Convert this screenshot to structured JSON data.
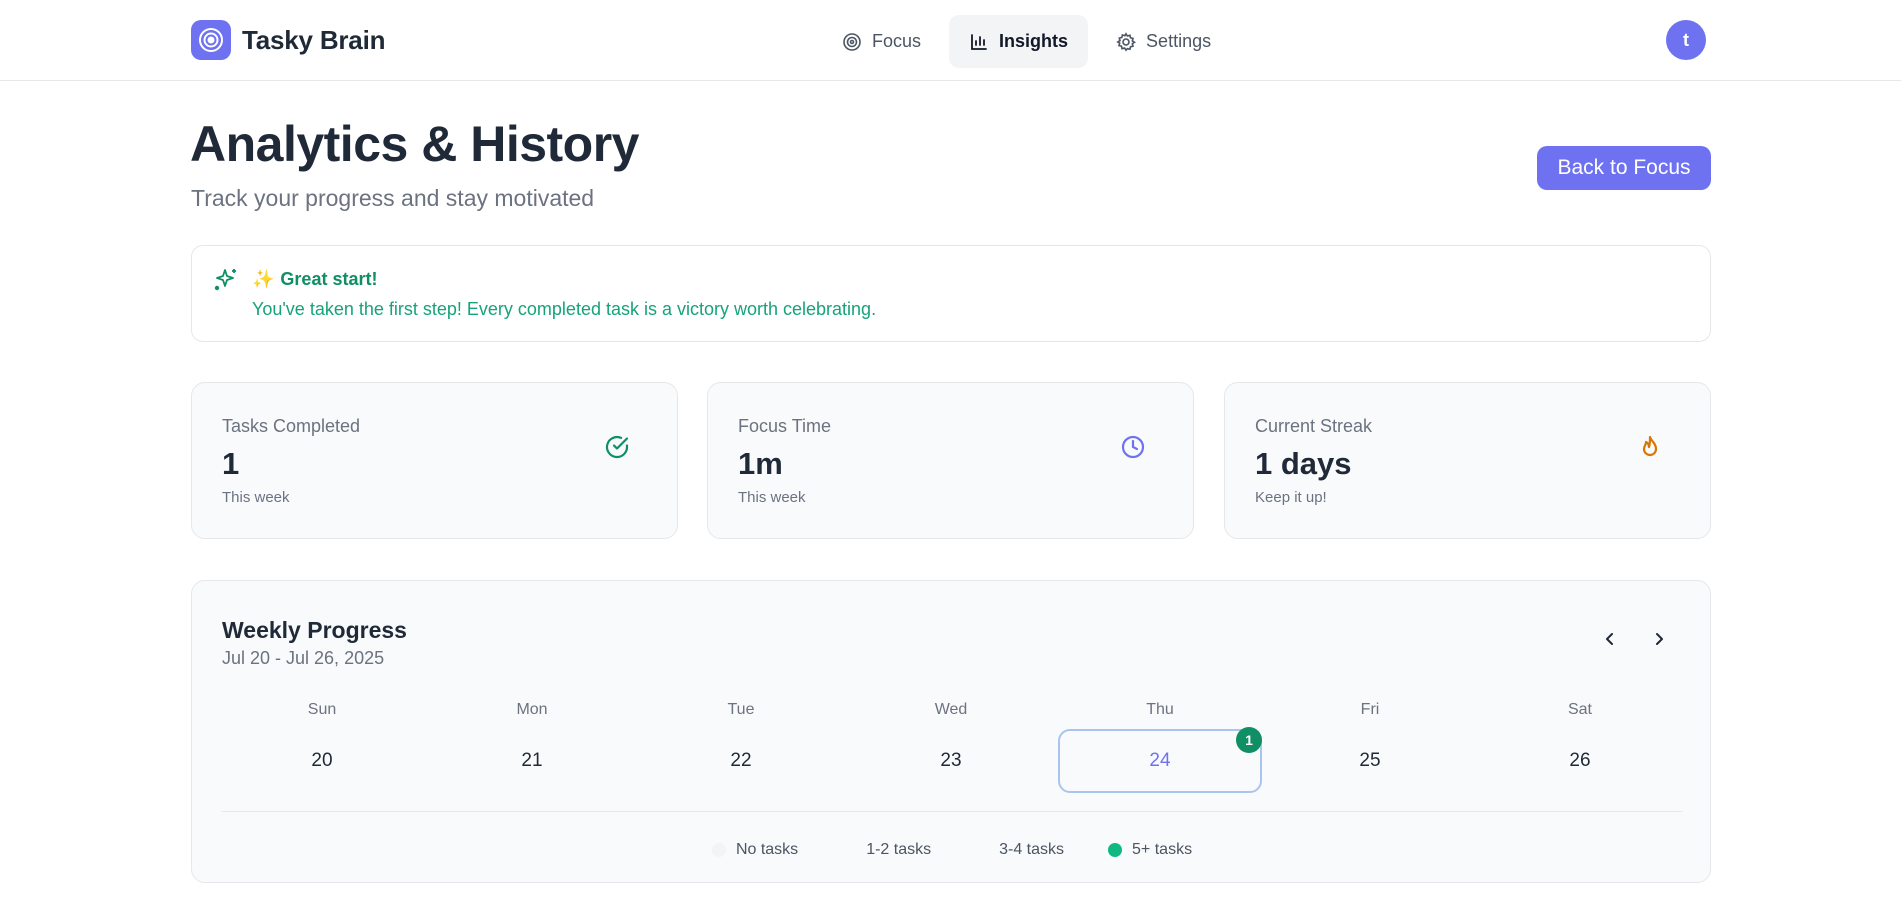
{
  "app": {
    "name": "Tasky Brain",
    "avatar_initial": "t",
    "accent_color": "#6e72f0"
  },
  "nav": {
    "items": [
      {
        "label": "Focus",
        "icon": "target-icon",
        "active": false
      },
      {
        "label": "Insights",
        "icon": "bar-chart-icon",
        "active": true
      },
      {
        "label": "Settings",
        "icon": "gear-icon",
        "active": false
      }
    ]
  },
  "page": {
    "title": "Analytics & History",
    "subtitle": "Track your progress and stay motivated",
    "back_button_label": "Back to Focus"
  },
  "banner": {
    "emoji": "✨",
    "title": "Great start!",
    "message": "You've taken the first step! Every completed task is a victory worth celebrating.",
    "icon": "sparkles-icon",
    "color": "#0f8f63"
  },
  "stats": [
    {
      "label": "Tasks Completed",
      "value": "1",
      "note": "This week",
      "icon": "check-circle-icon",
      "color": "#0f8f63"
    },
    {
      "label": "Focus Time",
      "value": "1m",
      "note": "This week",
      "icon": "clock-icon",
      "color": "#6e72f0"
    },
    {
      "label": "Current Streak",
      "value": "1 days",
      "note": "Keep it up!",
      "icon": "flame-icon",
      "color": "#d97706"
    }
  ],
  "weekly": {
    "title": "Weekly Progress",
    "range": "Jul 20 - Jul 26, 2025",
    "days": [
      {
        "name": "Sun",
        "date": "20",
        "count": 0,
        "today": false
      },
      {
        "name": "Mon",
        "date": "21",
        "count": 0,
        "today": false
      },
      {
        "name": "Tue",
        "date": "22",
        "count": 0,
        "today": false
      },
      {
        "name": "Wed",
        "date": "23",
        "count": 0,
        "today": false
      },
      {
        "name": "Thu",
        "date": "24",
        "count": 1,
        "badge": "1",
        "today": true
      },
      {
        "name": "Fri",
        "date": "25",
        "count": 0,
        "today": false
      },
      {
        "name": "Sat",
        "date": "26",
        "count": 0,
        "today": false
      }
    ],
    "legend": [
      {
        "label": "No tasks",
        "color": "#f3f4f6"
      },
      {
        "label": "1-2 tasks",
        "color": "#f9fafb"
      },
      {
        "label": "3-4 tasks",
        "color": "#f9fafb"
      },
      {
        "label": "5+ tasks",
        "color": "#10b981"
      }
    ]
  }
}
